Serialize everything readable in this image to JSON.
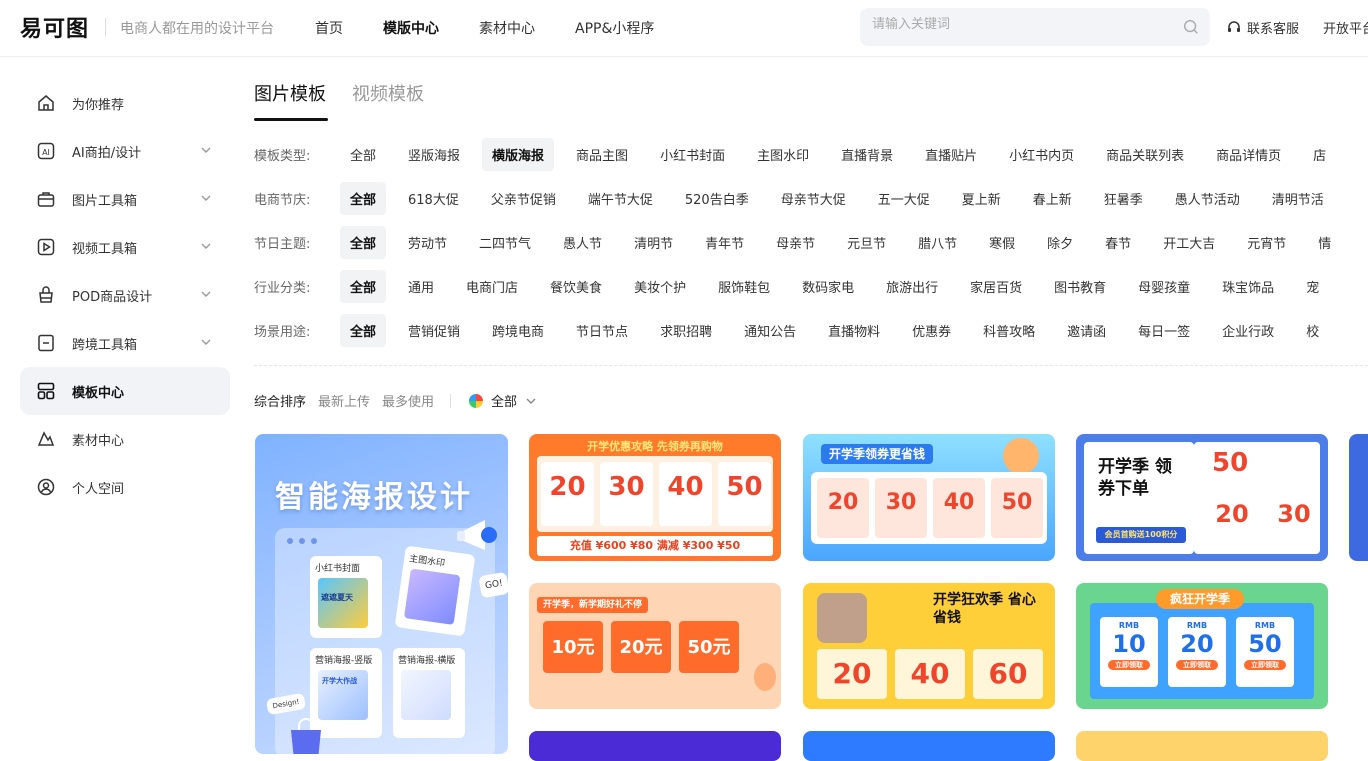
{
  "header": {
    "logo": "易可图",
    "slogan": "电商人都在用的设计平台",
    "nav": [
      "首页",
      "模版中心",
      "素材中心",
      "APP&小程序"
    ],
    "search_placeholder": "请输入关键词",
    "service": "联系客服",
    "open_platform": "开放平台"
  },
  "sidebar": {
    "items": [
      {
        "label": "为你推荐",
        "icon": "home-icon"
      },
      {
        "label": "AI商拍/设计",
        "icon": "ai-icon"
      },
      {
        "label": "图片工具箱",
        "icon": "toolbox-icon"
      },
      {
        "label": "视频工具箱",
        "icon": "video-icon"
      },
      {
        "label": "POD商品设计",
        "icon": "bag-icon"
      },
      {
        "label": "跨境工具箱",
        "icon": "crossborder-icon"
      },
      {
        "label": "模板中心",
        "icon": "template-icon"
      },
      {
        "label": "素材中心",
        "icon": "material-icon"
      },
      {
        "label": "个人空间",
        "icon": "user-icon"
      }
    ]
  },
  "tabs": [
    "图片模板",
    "视频模板"
  ],
  "filters": [
    {
      "label": "模板类型:",
      "chips": [
        "全部",
        "竖版海报",
        "横版海报",
        "商品主图",
        "小红书封面",
        "主图水印",
        "直播背景",
        "直播贴片",
        "小红书内页",
        "商品关联列表",
        "商品详情页",
        "店"
      ]
    },
    {
      "label": "电商节庆:",
      "chips": [
        "全部",
        "618大促",
        "父亲节促销",
        "端午节大促",
        "520告白季",
        "母亲节大促",
        "五一大促",
        "夏上新",
        "春上新",
        "狂暑季",
        "愚人节活动",
        "清明节活"
      ]
    },
    {
      "label": "节日主题:",
      "chips": [
        "全部",
        "劳动节",
        "二四节气",
        "愚人节",
        "清明节",
        "青年节",
        "母亲节",
        "元旦节",
        "腊八节",
        "寒假",
        "除夕",
        "春节",
        "开工大吉",
        "元宵节",
        "情"
      ]
    },
    {
      "label": "行业分类:",
      "chips": [
        "全部",
        "通用",
        "电商门店",
        "餐饮美食",
        "美妆个护",
        "服饰鞋包",
        "数码家电",
        "旅游出行",
        "家居百货",
        "图书教育",
        "母婴孩童",
        "珠宝饰品",
        "宠"
      ]
    },
    {
      "label": "场景用途:",
      "chips": [
        "全部",
        "营销促销",
        "跨境电商",
        "节日节点",
        "求职招聘",
        "通知公告",
        "直播物料",
        "优惠券",
        "科普攻略",
        "邀请函",
        "每日一签",
        "企业行政",
        "校"
      ]
    }
  ],
  "sort": {
    "options": [
      "综合排序",
      "最新上传",
      "最多使用"
    ],
    "color_filter": "全部"
  },
  "cards": {
    "big": {
      "title": "智能海报设计",
      "mini1": "小红书封面",
      "mini1_text": "遮遮夏天",
      "mini2": "主图水印",
      "mini3": "营销海报-竖版",
      "mini3_text": "开学大作战",
      "mini4": "营销海报-横版",
      "go": "GO!",
      "design": "Design!"
    },
    "c1": {
      "banner": "开学优惠攻略 先领券再购物",
      "coupons": [
        "20",
        "30",
        "40",
        "50"
      ],
      "bottom": "充值 ¥600 ¥80 满减 ¥300 ¥50"
    },
    "c2": {
      "banner": "开学季领券更省钱",
      "coupons": [
        "20",
        "30",
        "40",
        "50"
      ]
    },
    "c3": {
      "banner": "开学季 领券下单",
      "big": "50",
      "coupons": [
        "20",
        "30"
      ],
      "bottom": "会员首购送100积分"
    },
    "c4": {
      "banner": "开学季，新学期好礼不停",
      "coupons": [
        "10元",
        "20元",
        "50元"
      ]
    },
    "c5": {
      "banner": "开学狂欢季 省心省钱",
      "coupons": [
        "20",
        "40",
        "60"
      ]
    },
    "c6": {
      "banner": "疯狂开学季",
      "coupons": [
        "10",
        "20",
        "50"
      ],
      "unit": "RMB",
      "btn": "立即领取"
    }
  }
}
